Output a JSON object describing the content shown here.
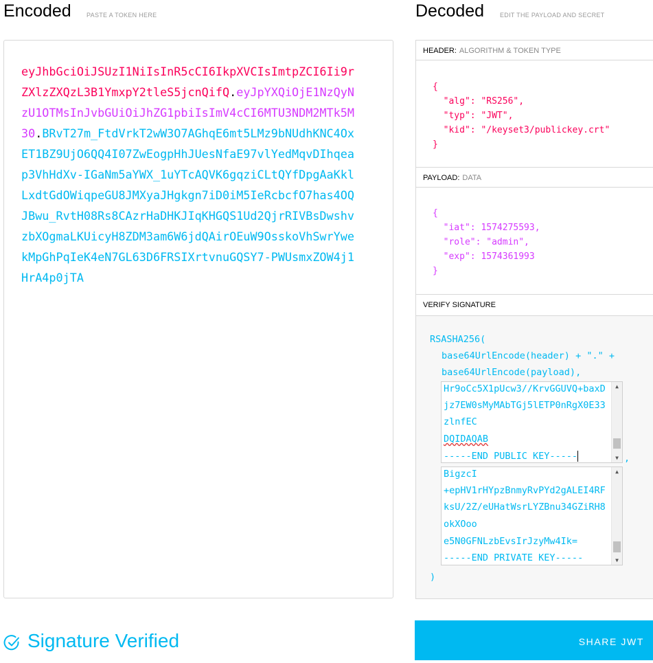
{
  "encoded": {
    "title": "Encoded",
    "subtitle": "PASTE A TOKEN HERE",
    "token": {
      "header": "eyJhbGciOiJSUzI1NiIsInR5cCI6IkpXVCIsImtpZCI6Ii9rZXlzZXQzL3B1YmxpY2tleS5jcnQifQ",
      "payload": "eyJpYXQiOjE1NzQyNzU1OTMsInJvbGUiOiJhZG1pbiIsImV4cCI6MTU3NDM2MTk5M30",
      "signature": "BRvT27m_FtdVrkT2wW3O7AGhqE6mt5LMz9bNUdhKNC4OxET1BZ9UjO6QQ4I07ZwEogpHhJUesNfaE97vlYedMqvDIhqeap3VhHdXv-IGaNm5aYWX_1uYTcAQVK6gqziCLtQYfDpgAaKklLxdtGdOWiqpeGU8JMXyaJHgkgn7iD0iM5IeRcbcfO7has4OQJBwu_RvtH08Rs8CAzrHaDHKJIqKHGQS1Ud2QjrRIVBsDwshvzbXOgmaLKUicyH8ZDM3am6W6jdQAirOEuW9OsskoVhSwrYwekMpGhPqIeK4eN7GL63D6FRSIXrtvnuGQSY7-PWUsmxZOW4j1HrA4p0jTA"
    }
  },
  "decoded": {
    "title": "Decoded",
    "subtitle": "EDIT THE PAYLOAD AND SECRET",
    "header_section": {
      "label": "HEADER:",
      "sublabel": "ALGORITHM & TOKEN TYPE",
      "json": "{\n  \"alg\": \"RS256\",\n  \"typ\": \"JWT\",\n  \"kid\": \"/keyset3/publickey.crt\"\n}"
    },
    "payload_section": {
      "label": "PAYLOAD:",
      "sublabel": "DATA",
      "json": "{\n  \"iat\": 1574275593,\n  \"role\": \"admin\",\n  \"exp\": 1574361993\n}"
    },
    "signature_section": {
      "label": "VERIFY SIGNATURE",
      "function": "RSASHA256(",
      "line_header": "base64UrlEncode(header) + \".\" +",
      "line_payload": "base64UrlEncode(payload),",
      "comma": ",",
      "closing": ")",
      "public_key_lines": [
        "Hr9oCc5X1pUcw3//KrvGGUVQ+baxD",
        "jz7EW0sMyMAbTGj5lETP0nRgX0E33",
        "zlnfEC",
        "DQIDAQAB",
        "-----END PUBLIC KEY-----"
      ],
      "private_key_lines": [
        "BigzcI",
        "+epHV1rHYpzBnmyRvPYd2gALEI4RF",
        "ksU/2Z/eUHatWsrLYZBnu34GZiRH8",
        "okXOoo",
        "e5N0GFNLzbEvsIrJzyMw4Ik=",
        "-----END PRIVATE KEY-----"
      ]
    }
  },
  "status": {
    "label": "Signature Verified",
    "icon": "check-circle-icon"
  },
  "share_button": {
    "label": "SHARE JWT"
  },
  "colors": {
    "header": "#fb015b",
    "payload": "#d63aff",
    "signature": "#00b9f1"
  }
}
